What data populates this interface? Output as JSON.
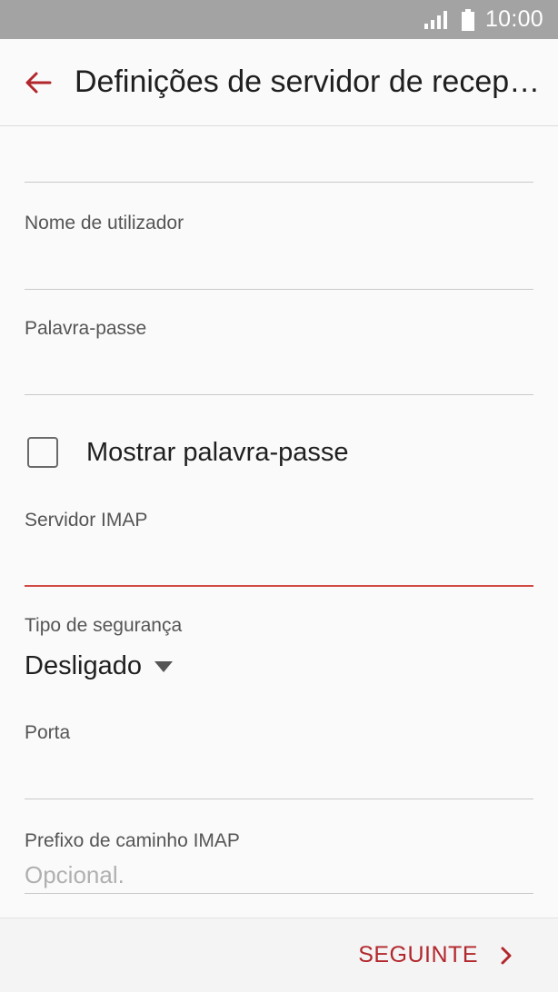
{
  "status_bar": {
    "time": "10:00",
    "signal_icon": "signal-icon",
    "battery_icon": "battery-icon"
  },
  "app_bar": {
    "title": "Definições de servidor de recepç...",
    "back_icon": "arrow-back-icon"
  },
  "form": {
    "fields": [
      {
        "label": "Nome de utilizador",
        "value": "",
        "placeholder": ""
      },
      {
        "label": "Palavra-passe",
        "value": "",
        "placeholder": ""
      },
      {
        "label": "Servidor IMAP",
        "value": "",
        "placeholder": ""
      },
      {
        "label": "Porta",
        "value": "",
        "placeholder": ""
      },
      {
        "label": "Prefixo de caminho IMAP",
        "value": "",
        "placeholder": "Opcional."
      }
    ],
    "show_password": {
      "label": "Mostrar palavra-passe",
      "checked": false
    },
    "security": {
      "label": "Tipo de segurança",
      "value": "Desligado"
    }
  },
  "footer": {
    "next_label": "SEGUINTE"
  },
  "colors": {
    "accent": "#b2272c",
    "active_underline": "#d24a45",
    "status_bar": "#a3a3a3"
  }
}
